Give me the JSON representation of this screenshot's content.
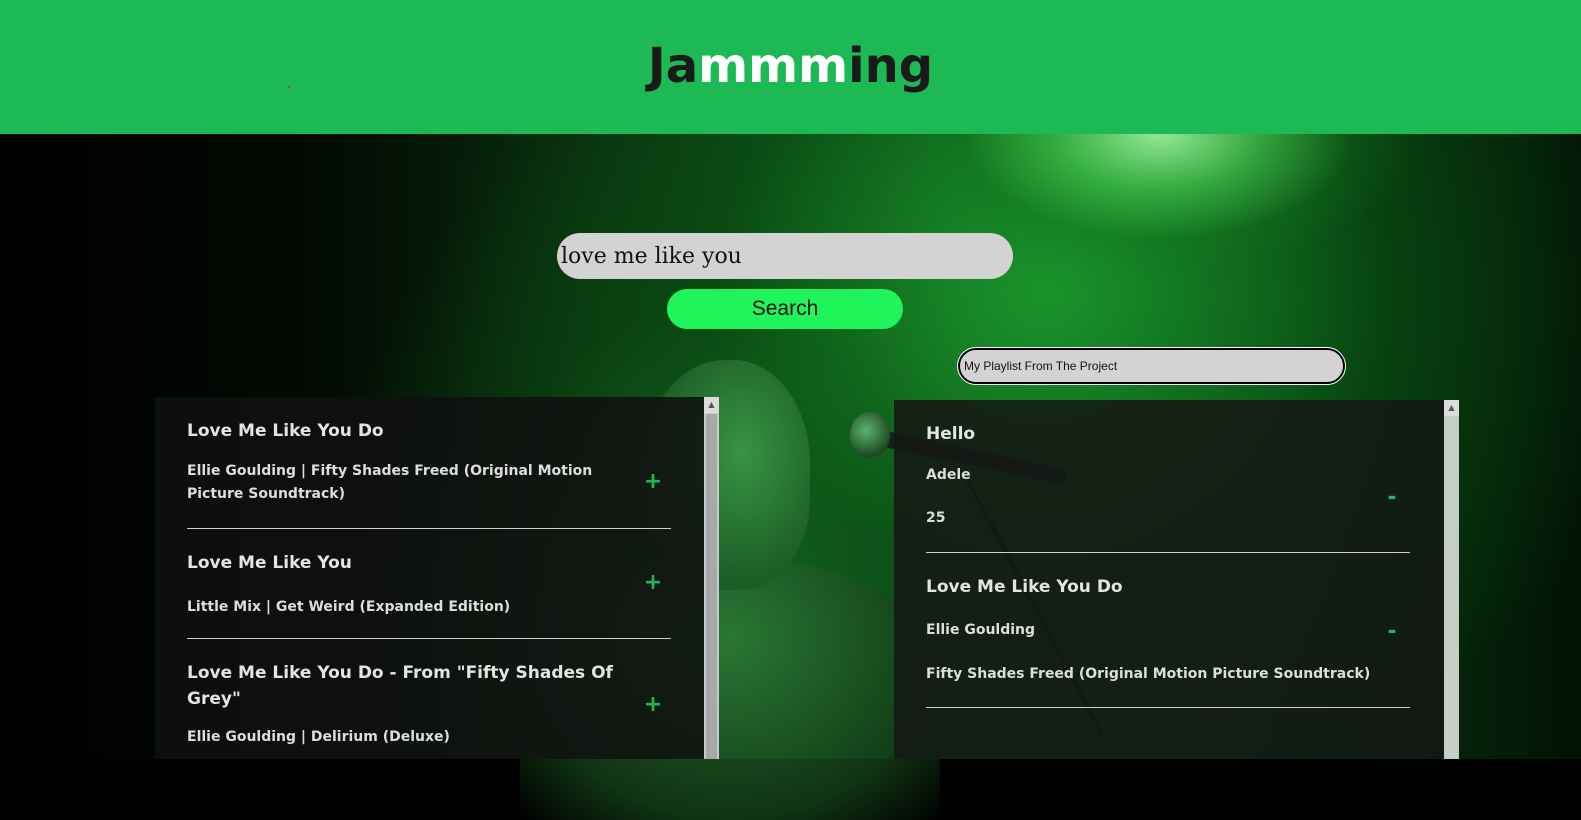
{
  "header": {
    "title_prefix": "Ja",
    "title_accent": "mmm",
    "title_suffix": "ing"
  },
  "search": {
    "value": "love me like you",
    "button_label": "Search"
  },
  "playlist": {
    "name_value": "My Playlist From The Project",
    "tracks": [
      {
        "name": "Hello",
        "artist": "Adele",
        "album": "25",
        "action": "-"
      },
      {
        "name": "Love Me Like You Do",
        "artist": "Ellie Goulding",
        "album": "Fifty Shades Freed (Original Motion Picture Soundtrack)",
        "action": "-"
      }
    ]
  },
  "results": {
    "tracks": [
      {
        "name": "Love Me Like You Do",
        "info": "Ellie Goulding | Fifty Shades Freed (Original Motion Picture Soundtrack)",
        "action": "+"
      },
      {
        "name": "Love Me Like You",
        "info": "Little Mix | Get Weird (Expanded Edition)",
        "action": "+"
      },
      {
        "name": "Love Me Like You Do - From \"Fifty Shades Of Grey\"",
        "info": "Ellie Goulding | Delirium (Deluxe)",
        "action": "+"
      }
    ]
  },
  "colors": {
    "brand_green": "#1db954",
    "search_button": "#1ff45a",
    "input_bg": "#d3d3d3"
  },
  "icons": {
    "scroll_up": "scroll-up-arrow-icon"
  }
}
